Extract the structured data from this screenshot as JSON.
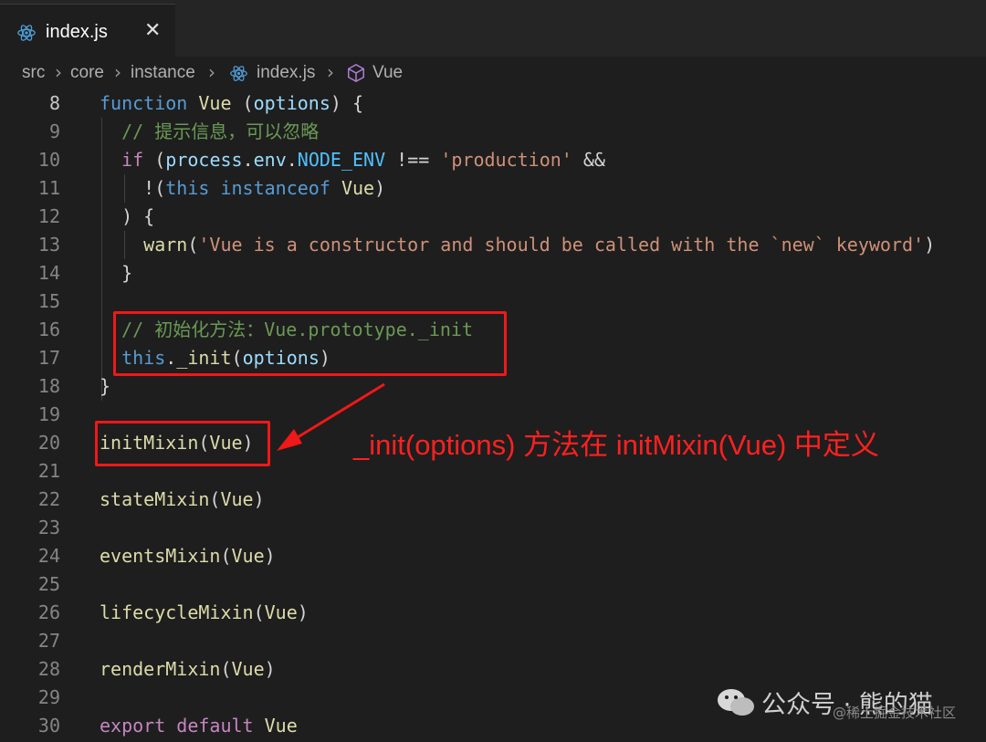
{
  "tab": {
    "label": "index.js",
    "close": "✕"
  },
  "breadcrumb": [
    "src",
    "core",
    "instance",
    "index.js",
    "Vue"
  ],
  "lines": [
    {
      "n": "8",
      "tokens": [
        [
          "kw",
          "function"
        ],
        [
          "",
          " "
        ],
        [
          "fn",
          "Vue"
        ],
        [
          "",
          " ("
        ],
        [
          "vr",
          "options"
        ],
        [
          "",
          ") {"
        ]
      ]
    },
    {
      "n": "9",
      "tokens": [
        [
          "",
          "  "
        ],
        [
          "cmt",
          "// 提示信息，可以忽略"
        ]
      ]
    },
    {
      "n": "10",
      "tokens": [
        [
          "",
          "  "
        ],
        [
          "ctl",
          "if"
        ],
        [
          "",
          ""
        ],
        [
          "",
          " ("
        ],
        [
          "vr",
          "process"
        ],
        [
          "",
          "."
        ],
        [
          "vr",
          "env"
        ],
        [
          "",
          "."
        ],
        [
          "cst",
          "NODE_ENV"
        ],
        [
          "",
          " !== "
        ],
        [
          "str",
          "'production'"
        ],
        [
          "",
          " &&"
        ]
      ]
    },
    {
      "n": "11",
      "tokens": [
        [
          "",
          "    !("
        ],
        [
          "kw",
          "this"
        ],
        [
          "",
          " "
        ],
        [
          "kw",
          "instanceof"
        ],
        [
          "",
          " "
        ],
        [
          "fn",
          "Vue"
        ],
        [
          "",
          ")"
        ]
      ]
    },
    {
      "n": "12",
      "tokens": [
        [
          "",
          "  ) {"
        ]
      ]
    },
    {
      "n": "13",
      "tokens": [
        [
          "",
          "    "
        ],
        [
          "fn",
          "warn"
        ],
        [
          "",
          "("
        ],
        [
          "str",
          "'Vue is a constructor and should be called with the `new` keyword'"
        ],
        [
          "",
          ")"
        ]
      ]
    },
    {
      "n": "14",
      "tokens": [
        [
          "",
          "  }"
        ]
      ]
    },
    {
      "n": "15",
      "tokens": []
    },
    {
      "n": "16",
      "tokens": [
        [
          "",
          "  "
        ],
        [
          "cmt",
          "// 初始化方法：Vue.prototype._init"
        ]
      ]
    },
    {
      "n": "17",
      "tokens": [
        [
          "",
          "  "
        ],
        [
          "kw",
          "this"
        ],
        [
          "",
          "."
        ],
        [
          "fn",
          "_init"
        ],
        [
          "",
          "("
        ],
        [
          "vr",
          "options"
        ],
        [
          "",
          ")"
        ]
      ]
    },
    {
      "n": "18",
      "tokens": [
        [
          "",
          "}"
        ]
      ]
    },
    {
      "n": "19",
      "tokens": []
    },
    {
      "n": "20",
      "tokens": [
        [
          "fn",
          "initMixin"
        ],
        [
          "",
          "("
        ],
        [
          "fn",
          "Vue"
        ],
        [
          "",
          ")"
        ]
      ]
    },
    {
      "n": "21",
      "tokens": []
    },
    {
      "n": "22",
      "tokens": [
        [
          "fn",
          "stateMixin"
        ],
        [
          "",
          "("
        ],
        [
          "fn",
          "Vue"
        ],
        [
          "",
          ")"
        ]
      ]
    },
    {
      "n": "23",
      "tokens": []
    },
    {
      "n": "24",
      "tokens": [
        [
          "fn",
          "eventsMixin"
        ],
        [
          "",
          "("
        ],
        [
          "fn",
          "Vue"
        ],
        [
          "",
          ")"
        ]
      ]
    },
    {
      "n": "25",
      "tokens": []
    },
    {
      "n": "26",
      "tokens": [
        [
          "fn",
          "lifecycleMixin"
        ],
        [
          "",
          "("
        ],
        [
          "fn",
          "Vue"
        ],
        [
          "",
          ")"
        ]
      ]
    },
    {
      "n": "27",
      "tokens": []
    },
    {
      "n": "28",
      "tokens": [
        [
          "fn",
          "renderMixin"
        ],
        [
          "",
          "("
        ],
        [
          "fn",
          "Vue"
        ],
        [
          "",
          ")"
        ]
      ]
    },
    {
      "n": "29",
      "tokens": []
    },
    {
      "n": "30",
      "tokens": [
        [
          "ctl",
          "export"
        ],
        [
          "",
          " "
        ],
        [
          "ctl",
          "default"
        ],
        [
          "",
          " "
        ],
        [
          "fn",
          "Vue"
        ]
      ]
    }
  ],
  "annotation": "_init(options) 方法在 initMixin(Vue)  中定义",
  "watermark": {
    "text": "公众号 · 熊的猫",
    "sub": "@稀土掘金技术社区"
  },
  "colors": {
    "highlight": "#f01818",
    "background": "#1e1e1e"
  }
}
